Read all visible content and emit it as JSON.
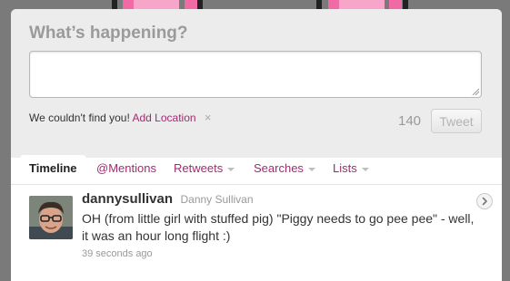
{
  "compose": {
    "heading": "What’s happening?",
    "textarea_value": "",
    "geo_prefix": "We couldn't find you!",
    "geo_link": "Add Location",
    "geo_remove": "×",
    "char_count": "140",
    "tweet_button": "Tweet"
  },
  "tabs": [
    {
      "label": "Timeline",
      "active": true
    },
    {
      "label": "@Mentions"
    },
    {
      "label": "Retweets",
      "has_menu": true
    },
    {
      "label": "Searches",
      "has_menu": true
    },
    {
      "label": "Lists",
      "has_menu": true
    }
  ],
  "status": {
    "username": "dannysullivan",
    "fullname": "Danny Sullivan",
    "text": "OH (from little girl with stuffed pig) \"Piggy needs to go pee pee\" - well, it was an hour long flight :)",
    "timestamp": "39 seconds ago"
  },
  "colors": {
    "link": "#a02c6f",
    "background_stripe_pink": "#f06aa6",
    "panel_bg": "#ececec"
  },
  "icons": {
    "remove_location": "close-icon",
    "tab_menu": "caret-down-icon",
    "tweet_actions": "chevron-right-icon"
  }
}
